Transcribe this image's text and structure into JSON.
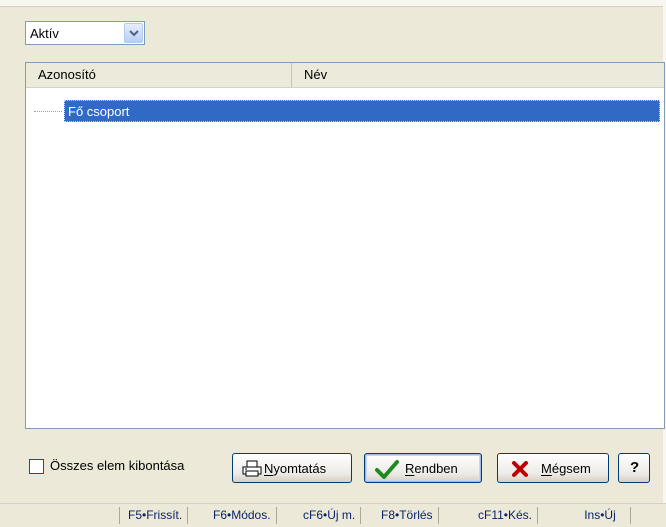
{
  "filter": {
    "selected": "Aktív"
  },
  "table": {
    "columns": [
      "Azonosító",
      "Név"
    ],
    "tree": [
      {
        "label": "Fő csoport",
        "selected": true
      }
    ]
  },
  "options": {
    "expand_all_label": "Összes elem kibontása",
    "expand_all_checked": false
  },
  "buttons": {
    "print": "Nyomtatás",
    "ok": "Rendben",
    "cancel": "Mégsem",
    "help": "?"
  },
  "statusbar": {
    "items": [
      "F5•Frissít.",
      "F6•Módos.",
      "cF6•Új m.",
      "F8•Törlés",
      "cF11•Kés.",
      "Ins•Új"
    ]
  },
  "colors": {
    "selection": "#316ac5",
    "face": "#ece9d8",
    "border": "#7f9db9"
  }
}
